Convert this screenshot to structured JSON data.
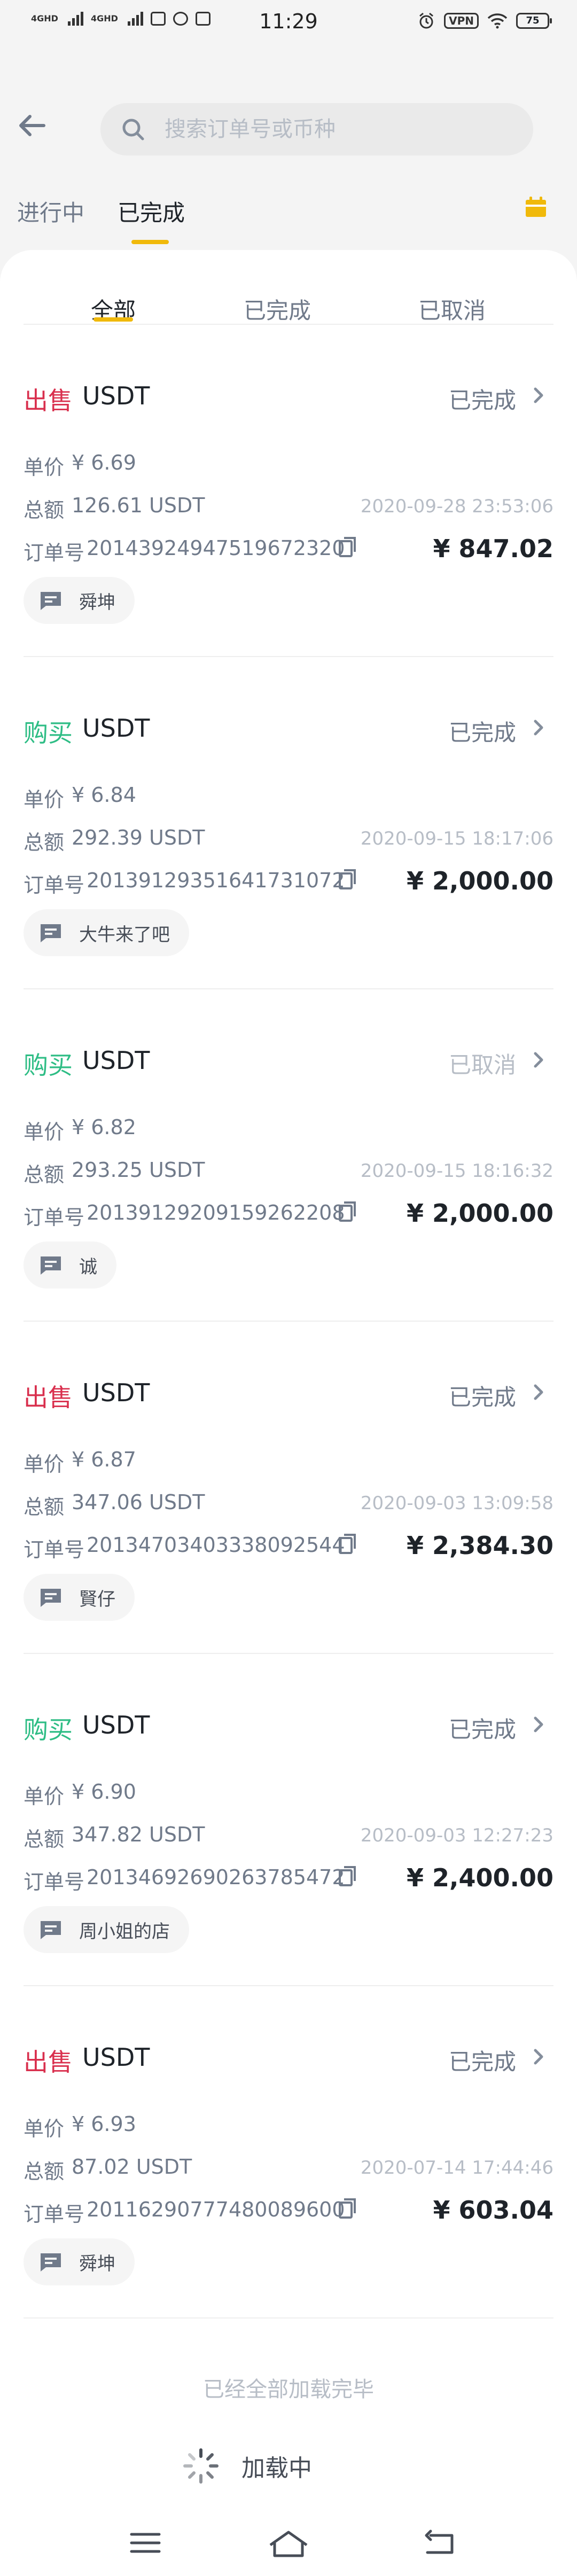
{
  "status_bar": {
    "network_1": "4GHD",
    "network_2": "4GHD",
    "time": "11:29",
    "vpn": "VPN",
    "battery": "75"
  },
  "search": {
    "placeholder": "搜索订单号或币种"
  },
  "top_tabs": [
    {
      "label": "进行中",
      "active": false
    },
    {
      "label": "已完成",
      "active": true
    }
  ],
  "sub_tabs": [
    {
      "label": "全部",
      "active": true
    },
    {
      "label": "已完成",
      "active": false
    },
    {
      "label": "已取消",
      "active": false
    }
  ],
  "labels": {
    "unit_price": "单价",
    "total": "总额",
    "order_no": "订单号"
  },
  "orders": [
    {
      "type": "出售",
      "side": "sell",
      "coin": "USDT",
      "status": "已完成",
      "price": "¥ 6.69",
      "total": "126.61 USDT",
      "date": "2020-09-28 23:53:06",
      "order_no": "20143924947519672320",
      "amount": "¥ 847.02",
      "counterparty": "舜坤"
    },
    {
      "type": "购买",
      "side": "buy",
      "coin": "USDT",
      "status": "已完成",
      "price": "¥ 6.84",
      "total": "292.39 USDT",
      "date": "2020-09-15 18:17:06",
      "order_no": "20139129351641731072",
      "amount": "¥ 2,000.00",
      "counterparty": "大牛来了吧"
    },
    {
      "type": "购买",
      "side": "buy",
      "coin": "USDT",
      "status": "已取消",
      "price": "¥ 6.82",
      "total": "293.25 USDT",
      "date": "2020-09-15 18:16:32",
      "order_no": "20139129209159262208",
      "amount": "¥ 2,000.00",
      "counterparty": "诚"
    },
    {
      "type": "出售",
      "side": "sell",
      "coin": "USDT",
      "status": "已完成",
      "price": "¥ 6.87",
      "total": "347.06 USDT",
      "date": "2020-09-03 13:09:58",
      "order_no": "20134703403338092544",
      "amount": "¥ 2,384.30",
      "counterparty": "賢仔"
    },
    {
      "type": "购买",
      "side": "buy",
      "coin": "USDT",
      "status": "已完成",
      "price": "¥ 6.90",
      "total": "347.82 USDT",
      "date": "2020-09-03 12:27:23",
      "order_no": "20134692690263785472",
      "amount": "¥ 2,400.00",
      "counterparty": "周小姐的店"
    },
    {
      "type": "出售",
      "side": "sell",
      "coin": "USDT",
      "status": "已完成",
      "price": "¥ 6.93",
      "total": "87.02 USDT",
      "date": "2020-07-14 17:44:46",
      "order_no": "20116290777480089600",
      "amount": "¥ 603.04",
      "counterparty": "舜坤"
    }
  ],
  "footer": {
    "end_text": "已经全部加载完毕",
    "loading_text": "加载中"
  },
  "colors": {
    "accent": "#f0b90b",
    "sell": "#d9304e",
    "buy": "#2ebd85"
  }
}
